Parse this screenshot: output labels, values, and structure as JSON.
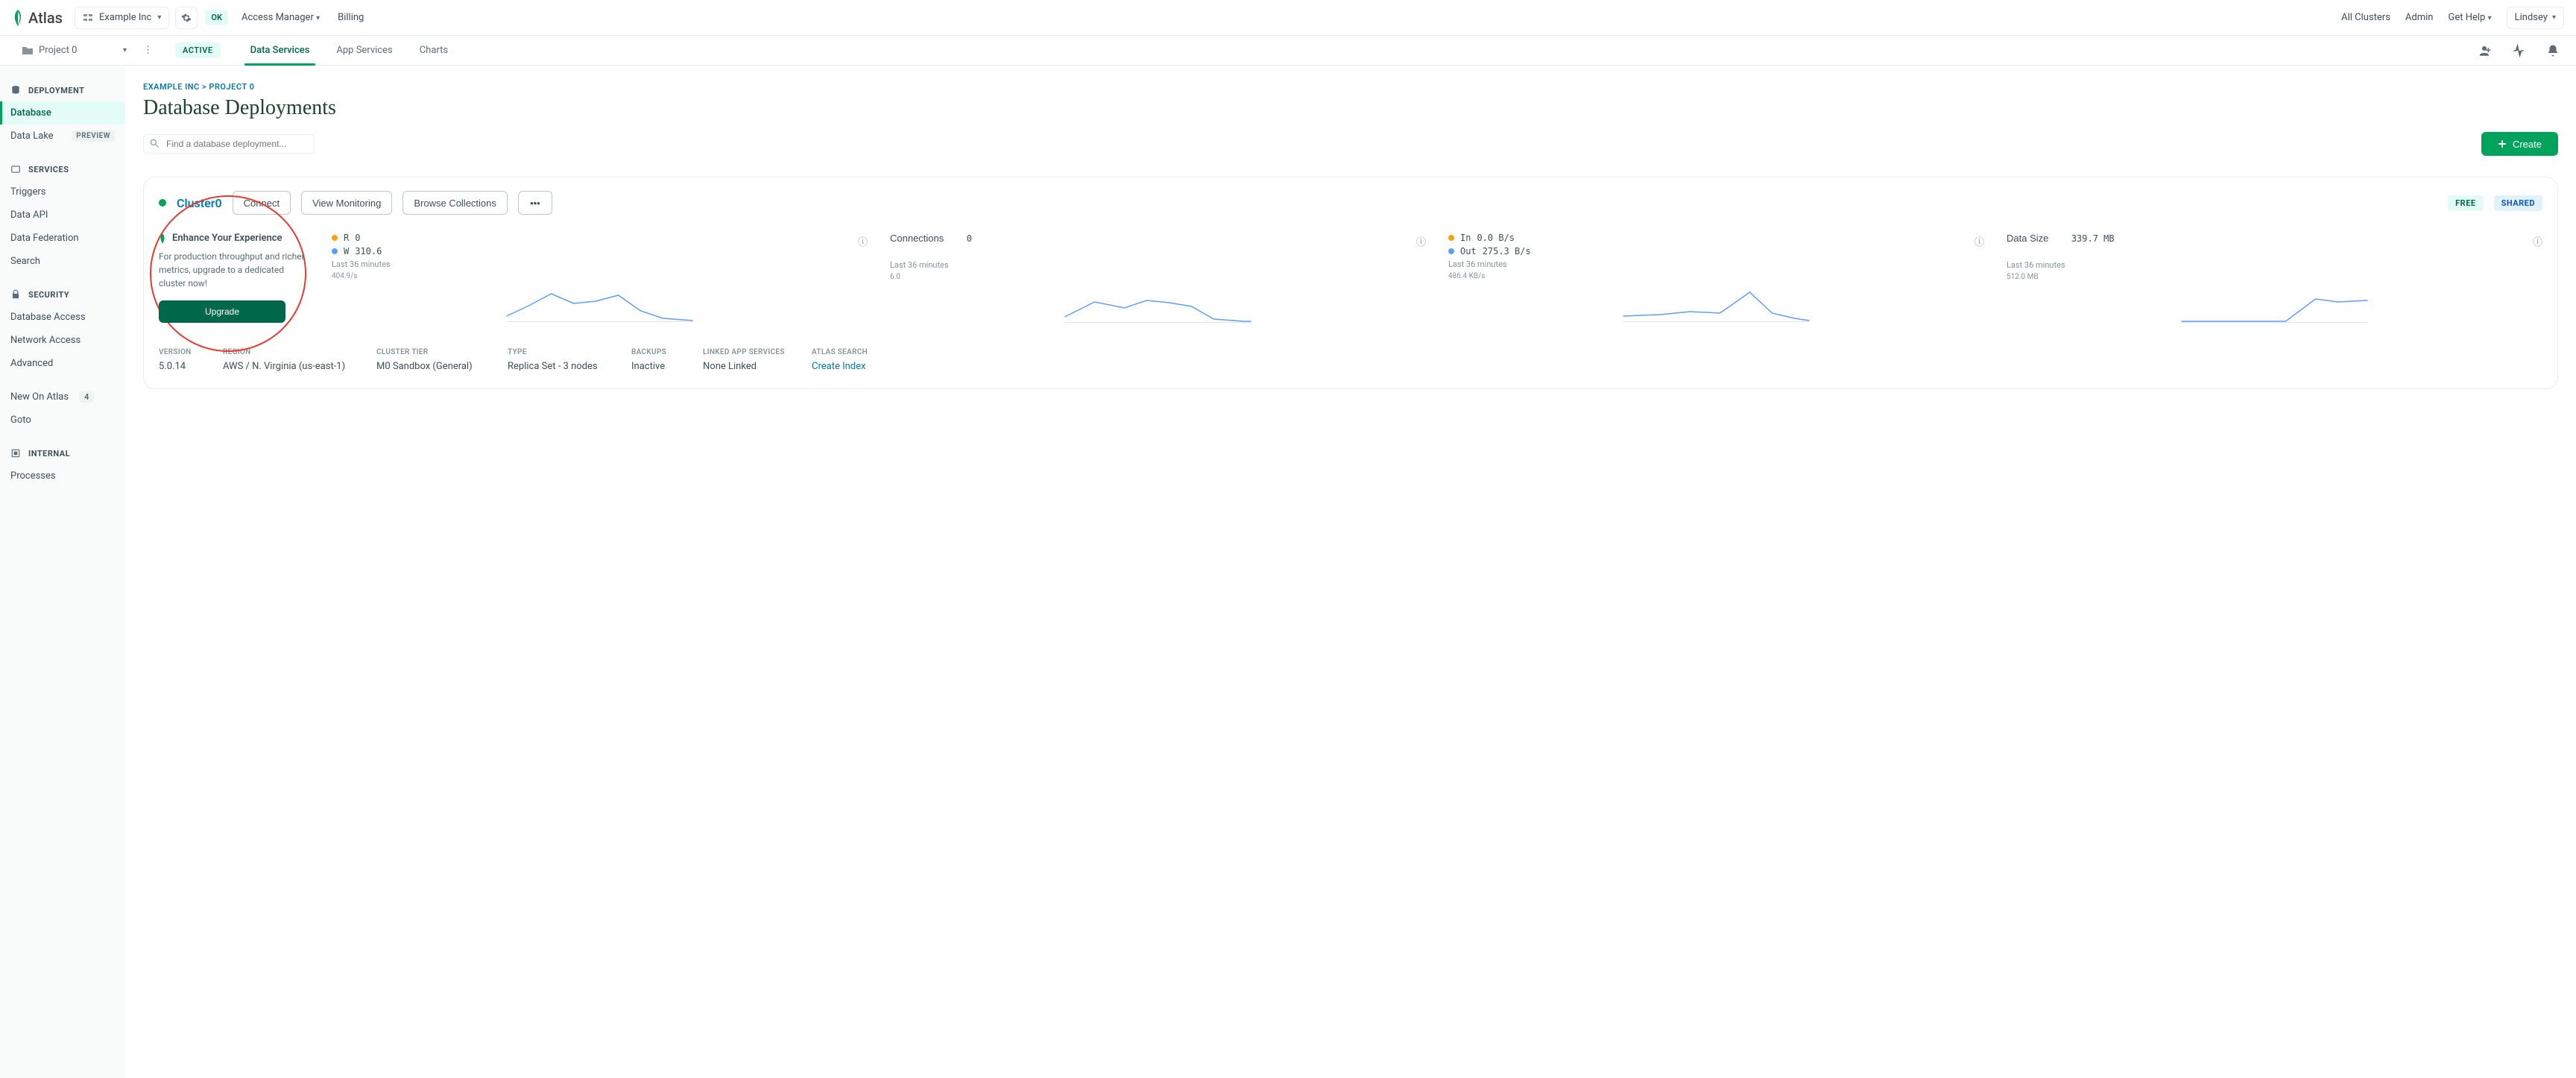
{
  "brand": "Atlas",
  "org": "Example Inc",
  "ok_badge": "OK",
  "nav": {
    "access_manager": "Access Manager",
    "billing": "Billing",
    "all_clusters": "All Clusters",
    "admin": "Admin",
    "get_help": "Get Help",
    "user": "Lindsey"
  },
  "project": "Project 0",
  "active_badge": "ACTIVE",
  "tabs": {
    "data_services": "Data Services",
    "app_services": "App Services",
    "charts": "Charts"
  },
  "sidebar": {
    "deployment": "DEPLOYMENT",
    "database": "Database",
    "data_lake": "Data Lake",
    "preview": "PREVIEW",
    "services": "SERVICES",
    "triggers": "Triggers",
    "data_api": "Data API",
    "data_federation": "Data Federation",
    "search": "Search",
    "security": "SECURITY",
    "db_access": "Database Access",
    "net_access": "Network Access",
    "advanced": "Advanced",
    "internal": "INTERNAL",
    "processes": "Processes",
    "new_on_atlas": "New On Atlas",
    "new_count": "4",
    "goto": "Goto"
  },
  "breadcrumb": {
    "org": "EXAMPLE INC",
    "sep": ">",
    "proj": "PROJECT 0"
  },
  "page_title": "Database Deployments",
  "search_placeholder": "Find a database deployment...",
  "create_label": "Create",
  "cluster": {
    "name": "Cluster0",
    "connect": "Connect",
    "view_monitoring": "View Monitoring",
    "browse": "Browse Collections",
    "free": "FREE",
    "shared": "SHARED"
  },
  "enhance": {
    "title": "Enhance Your Experience",
    "text": "For production throughput and richer metrics, upgrade to a dedicated cluster now!",
    "button": "Upgrade"
  },
  "metrics": {
    "rw": {
      "r_label": "R",
      "r_val": "0",
      "w_label": "W",
      "w_val": "310.6",
      "last": "Last 36 minutes",
      "scale": "404.9/s"
    },
    "conn": {
      "label": "Connections",
      "val": "0",
      "last": "Last 36 minutes",
      "scale": "6.0"
    },
    "io": {
      "in_label": "In",
      "in_val": "0.0 B/s",
      "out_label": "Out",
      "out_val": "275.3 B/s",
      "last": "Last 36 minutes",
      "scale": "486.4 KB/s"
    },
    "size": {
      "label": "Data Size",
      "val": "339.7 MB",
      "last": "Last 36 minutes",
      "scale": "512.0 MB"
    }
  },
  "footer": {
    "version_l": "VERSION",
    "version": "5.0.14",
    "region_l": "REGION",
    "region": "AWS / N. Virginia (us-east-1)",
    "tier_l": "CLUSTER TIER",
    "tier": "M0 Sandbox (General)",
    "type_l": "TYPE",
    "type": "Replica Set - 3 nodes",
    "backups_l": "BACKUPS",
    "backups": "Inactive",
    "linked_l": "LINKED APP SERVICES",
    "linked": "None Linked",
    "search_l": "ATLAS SEARCH",
    "search": "Create Index"
  }
}
